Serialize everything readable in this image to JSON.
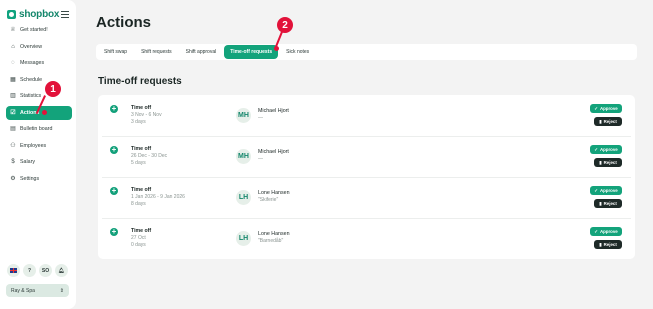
{
  "sidebar": {
    "logo": "shopbox",
    "items": [
      {
        "label": "Get started!",
        "icon": "trophy-icon",
        "glyph": "♕",
        "active": false
      },
      {
        "label": "Overview",
        "icon": "home-icon",
        "glyph": "⌂",
        "active": false
      },
      {
        "label": "Messages",
        "icon": "chat-icon",
        "glyph": "◌",
        "active": false
      },
      {
        "label": "Schedule",
        "icon": "calendar-icon",
        "glyph": "▦",
        "active": false
      },
      {
        "label": "Statistics",
        "icon": "chart-icon",
        "glyph": "▥",
        "active": false
      },
      {
        "label": "Actions",
        "icon": "checkbox-icon",
        "glyph": "☑",
        "active": true
      },
      {
        "label": "Bulletin board",
        "icon": "clipboard-icon",
        "glyph": "▤",
        "active": false
      },
      {
        "label": "Employees",
        "icon": "users-icon",
        "glyph": "⚇",
        "active": false
      },
      {
        "label": "Salary",
        "icon": "dollar-icon",
        "glyph": "$",
        "active": false
      },
      {
        "label": "Settings",
        "icon": "gear-icon",
        "glyph": "⚙",
        "active": false
      }
    ],
    "bottom": {
      "avatar_initials": "SO",
      "org_select": "Ray & Spa"
    }
  },
  "header": {
    "title": "Actions"
  },
  "tabs": [
    {
      "label": "Shift swap",
      "active": false
    },
    {
      "label": "Shift requests",
      "active": false
    },
    {
      "label": "Shift approval",
      "active": false
    },
    {
      "label": "Time-off requests",
      "active": true
    },
    {
      "label": "Sick notes",
      "active": false
    }
  ],
  "section": {
    "title": "Time-off requests"
  },
  "requests": [
    {
      "type": "Time off",
      "dates": "3 Nov - 6 Nov",
      "days": "3 days",
      "initials": "MH",
      "name": "Michael Hjort",
      "note": "—",
      "approve": "Approve",
      "reject": "Reject"
    },
    {
      "type": "Time off",
      "dates": "26 Dec - 30 Dec",
      "days": "5 days",
      "initials": "MH",
      "name": "Michael Hjort",
      "note": "—",
      "approve": "Approve",
      "reject": "Reject"
    },
    {
      "type": "Time off",
      "dates": "1 Jan 2026 - 9 Jan 2026",
      "days": "8 days",
      "initials": "LH",
      "name": "Lone Hansen",
      "note": "\"Skiferie\"",
      "approve": "Approve",
      "reject": "Reject"
    },
    {
      "type": "Time off",
      "dates": "27 Oct",
      "days": "0 days",
      "initials": "LH",
      "name": "Lone Hansen",
      "note": "\"Barnedåb\"",
      "approve": "Approve",
      "reject": "Reject"
    }
  ],
  "callouts": [
    "1",
    "2"
  ],
  "colors": {
    "accent": "#13a37b",
    "callout": "#e2123a",
    "reject": "#1e2a28"
  }
}
